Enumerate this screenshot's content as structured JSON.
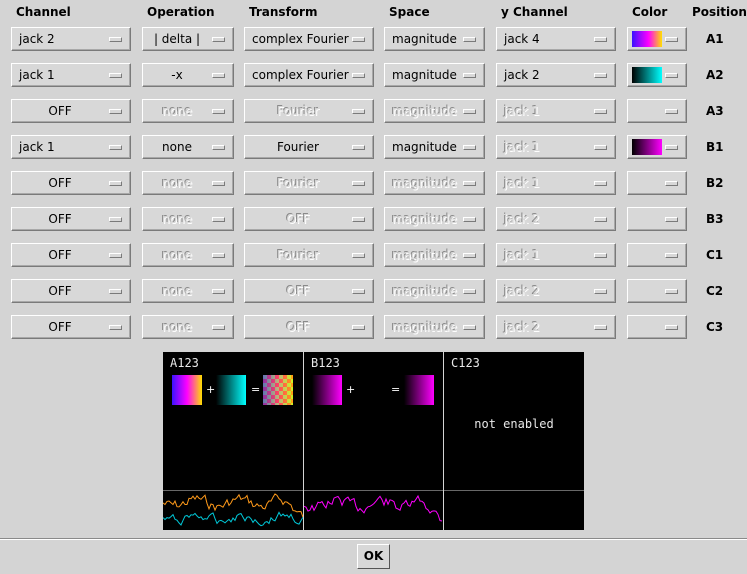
{
  "headers": {
    "channel": "Channel",
    "operation": "Operation",
    "transform": "Transform",
    "space": "Space",
    "ychannel": "y Channel",
    "color": "Color",
    "position": "Position"
  },
  "rows": [
    {
      "channel": "jack 2",
      "operation": "| delta |",
      "transform": "complex Fourier",
      "space": "magnitude",
      "ychannel": "jack 4",
      "color": "purple-blue-yellow",
      "position": "A1",
      "enabled": true
    },
    {
      "channel": "jack 1",
      "operation": "-x",
      "transform": "complex Fourier",
      "space": "magnitude",
      "ychannel": "jack 2",
      "color": "black-cyan",
      "position": "A2",
      "enabled": true
    },
    {
      "channel": "OFF",
      "operation": "none",
      "transform": "Fourier",
      "space": "magnitude",
      "ychannel": "jack 1",
      "color": "none",
      "position": "A3",
      "enabled": false
    },
    {
      "channel": "jack 1",
      "operation": "none",
      "transform": "Fourier",
      "space": "magnitude",
      "ychannel": "jack 1",
      "color": "black-magenta",
      "position": "B1",
      "enabled": true,
      "ychannel_disabled": true
    },
    {
      "channel": "OFF",
      "operation": "none",
      "transform": "Fourier",
      "space": "magnitude",
      "ychannel": "jack 1",
      "color": "none",
      "position": "B2",
      "enabled": false
    },
    {
      "channel": "OFF",
      "operation": "none",
      "transform": "OFF",
      "space": "magnitude",
      "ychannel": "jack 2",
      "color": "none",
      "position": "B3",
      "enabled": false
    },
    {
      "channel": "OFF",
      "operation": "none",
      "transform": "Fourier",
      "space": "magnitude",
      "ychannel": "jack 1",
      "color": "none",
      "position": "C1",
      "enabled": false
    },
    {
      "channel": "OFF",
      "operation": "none",
      "transform": "OFF",
      "space": "magnitude",
      "ychannel": "jack 2",
      "color": "none",
      "position": "C2",
      "enabled": false
    },
    {
      "channel": "OFF",
      "operation": "none",
      "transform": "OFF",
      "space": "magnitude",
      "ychannel": "jack 2",
      "color": "none",
      "position": "C3",
      "enabled": false
    }
  ],
  "preview": {
    "panels": [
      {
        "title": "A123",
        "plus": "+",
        "equals": "="
      },
      {
        "title": "B123",
        "plus": "+",
        "equals": "="
      },
      {
        "title": "C123",
        "message": "not enabled"
      }
    ]
  },
  "colors": {
    "trace_orange": "#ff9a1a",
    "trace_cyan": "#00c8d8",
    "trace_magenta": "#ff00ff"
  },
  "ok_label": "OK"
}
